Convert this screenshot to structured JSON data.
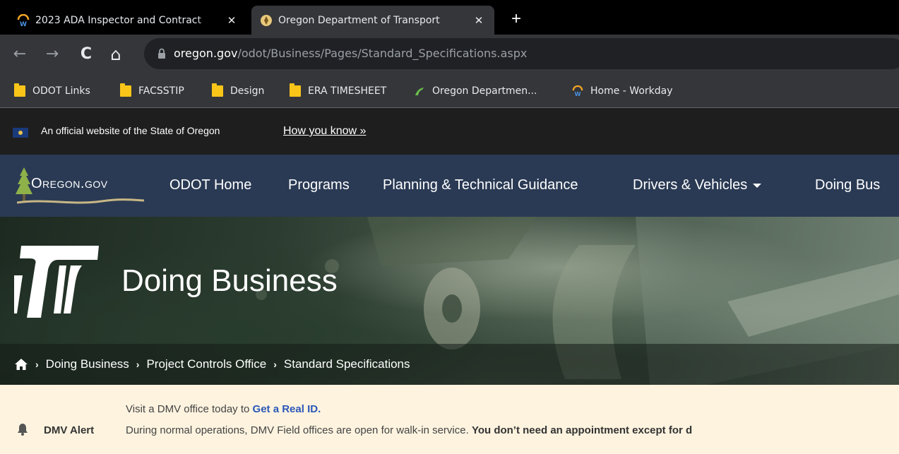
{
  "browser": {
    "tabs": [
      {
        "title": "2023 ADA Inspector and Contract",
        "active": false,
        "icon": "workday-icon"
      },
      {
        "title": "Oregon Department of Transport",
        "active": true,
        "icon": "oregon-icon"
      }
    ],
    "close_glyph": "✕",
    "new_tab_glyph": "+",
    "nav": {
      "back": "←",
      "forward": "→",
      "reload": "C",
      "home": "⌂"
    },
    "url": {
      "host": "oregon.gov",
      "path": "/odot/Business/Pages/Standard_Specifications.aspx"
    },
    "bookmarks": [
      {
        "label": "ODOT Links",
        "icon": "folder-icon"
      },
      {
        "label": "FACSSTIP",
        "icon": "folder-icon"
      },
      {
        "label": "Design",
        "icon": "folder-icon"
      },
      {
        "label": "ERA TIMESHEET",
        "icon": "folder-icon"
      },
      {
        "label": "Oregon Departmen...",
        "icon": "odot-favicon-icon"
      },
      {
        "label": "Home - Workday",
        "icon": "workday-icon"
      }
    ]
  },
  "official_banner": {
    "text": "An official website of the State of Oregon",
    "link": "How you know »"
  },
  "site_nav": {
    "logo_text": "Oregon.gov",
    "items": [
      "ODOT Home",
      "Programs",
      "Planning & Technical Guidance",
      "Drivers & Vehicles",
      "Doing Bus"
    ]
  },
  "hero": {
    "title": "Doing Business",
    "breadcrumbs": [
      "Doing Business",
      "Project Controls Office",
      "Standard Specifications"
    ],
    "separator": "›"
  },
  "alert": {
    "label": "DMV Alert",
    "line1_prefix": "Visit a DMV office today to ",
    "line1_link": "Get a Real ID.",
    "line2_text": "During normal operations, DMV Field offices are open for walk-in service. ",
    "line2_bold": "You don’t need an appointment except for d"
  },
  "colors": {
    "tabbar": "#000000",
    "toolbar": "#35363a",
    "nav_bg": "#2a3a54",
    "alert_bg": "#fdf3df",
    "link": "#2a58b8"
  }
}
